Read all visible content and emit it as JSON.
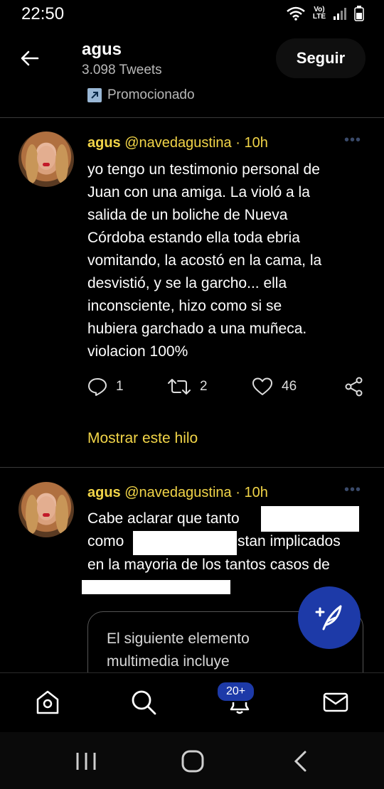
{
  "status_bar": {
    "time": "22:50",
    "network_top": "Vo)",
    "network_bottom": "LTE",
    "icons": [
      "wifi-icon",
      "signal-icon",
      "battery-icon"
    ]
  },
  "header": {
    "name": "agus",
    "tweet_count": "3.098 Tweets",
    "promoted_label": "Promocionado",
    "follow_label": "Seguir"
  },
  "tweets": [
    {
      "name": "agus",
      "handle": "@navedagustina",
      "time": "· 10h",
      "lines": [
        "yo tengo un testimonio personal de",
        "Juan con una amiga. La violó a la",
        "salida de un boliche de Nueva",
        "Córdoba estando ella toda ebria",
        "vomitando, la acostó en la cama, la",
        "desvistió, y se la garcho... ella",
        "inconsciente, hizo como si se",
        "hubiera garchado a una muñeca.",
        "violacion 100%"
      ],
      "replies": "1",
      "retweets": "2",
      "likes": "46",
      "show_thread": "Mostrar este hilo"
    },
    {
      "name": "agus",
      "handle": "@navedagustina",
      "time": "· 10h",
      "line1": "Cabe aclarar que tanto",
      "line2a": "como",
      "line2b": "stan implicados",
      "line3": "en la mayoria de los tantos casos de",
      "media_notice_1": "El siguiente elemento",
      "media_notice_2": "multimedia incluye"
    }
  ],
  "bottom_nav": {
    "notifications_badge": "20+",
    "items": [
      "home-icon",
      "search-icon",
      "notifications-icon",
      "messages-icon"
    ]
  },
  "colors": {
    "accent_yellow": "#f2d548",
    "fab_blue": "#1d3aa8",
    "background": "#000000"
  }
}
